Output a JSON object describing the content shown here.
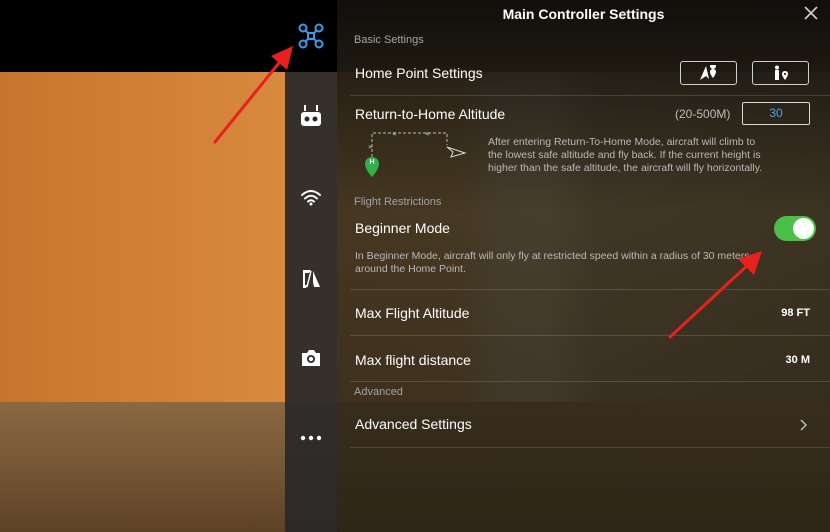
{
  "panel": {
    "title": "Main Controller Settings"
  },
  "basic": {
    "section_label": "Basic Settings",
    "home_point_label": "Home Point Settings",
    "rth_label": "Return-to-Home Altitude",
    "rth_range": "(20-500M)",
    "rth_value": "30",
    "rth_description_1": "After entering Return-To-Home Mode, aircraft will climb to",
    "rth_description_2": "the lowest safe altitude and fly back. If the current height is",
    "rth_description_3": "higher than the safe altitude, the aircraft will fly horizontally.",
    "home_marker": "H"
  },
  "flight_restrictions": {
    "section_label": "Flight Restrictions",
    "beginner_label": "Beginner Mode",
    "beginner_on": true,
    "beginner_description_1": "In Beginner Mode, aircraft will only fly at restricted speed within a radius of 30 meters",
    "beginner_description_2": "around the Home Point.",
    "max_altitude_label": "Max Flight Altitude",
    "max_altitude_value": "98 FT",
    "max_distance_label": "Max flight distance",
    "max_distance_value": "30 M"
  },
  "advanced": {
    "section_label": "Advanced",
    "settings_label": "Advanced Settings"
  },
  "colors": {
    "toggle_on": "#4cbf49",
    "active_icon": "#3d9be9",
    "annotation_arrow": "#e8201f"
  },
  "sidebar": {
    "icons": [
      "aircraft-icon",
      "remote-controller-icon",
      "wifi-icon",
      "vision-icon",
      "camera-icon",
      "more-icon"
    ]
  }
}
